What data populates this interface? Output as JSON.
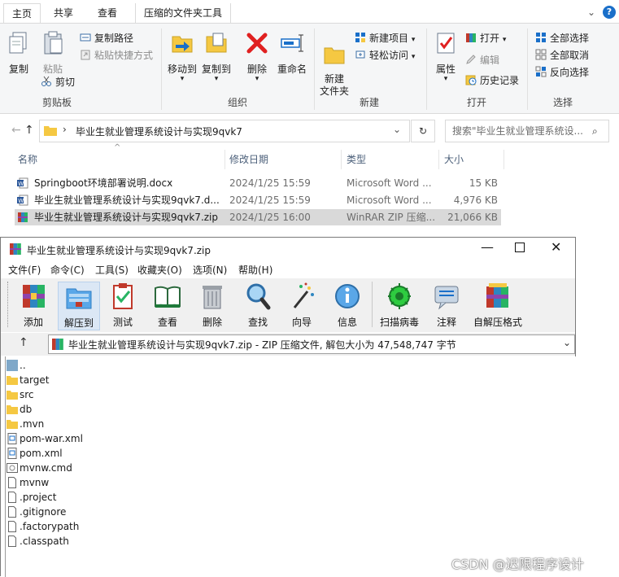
{
  "explorer": {
    "tabs": [
      "主页",
      "共享",
      "查看",
      "压缩的文件夹工具"
    ],
    "ribbon": {
      "clipboard": {
        "copy": "复制",
        "paste": "粘贴",
        "copy_path": "复制路径",
        "paste_shortcut": "粘贴快捷方式",
        "cut": "剪切",
        "label": "剪贴板"
      },
      "organize": {
        "move_to": "移动到",
        "copy_to": "复制到",
        "delete": "删除",
        "rename": "重命名",
        "label": "组织"
      },
      "new": {
        "new_folder": "新建\n文件夹",
        "new_item": "新建项目",
        "easy_access": "轻松访问",
        "label": "新建"
      },
      "open": {
        "properties": "属性",
        "open": "打开",
        "edit": "编辑",
        "history": "历史记录",
        "label": "打开"
      },
      "select": {
        "select_all": "全部选择",
        "select_none": "全部取消",
        "invert": "反向选择",
        "label": "选择"
      }
    },
    "address": {
      "path": "毕业生就业管理系统设计与实现9qvk7",
      "search_placeholder": "搜索\"毕业生就业管理系统设...",
      "separator": "›"
    },
    "columns": [
      "名称",
      "修改日期",
      "类型",
      "大小"
    ],
    "files": [
      {
        "name": "Springboot环境部署说明.docx",
        "date": "2024/1/25 15:59",
        "type": "Microsoft Word ...",
        "size": "15 KB",
        "icon": "word"
      },
      {
        "name": "毕业生就业管理系统设计与实现9qvk7.d...",
        "date": "2024/1/25 15:59",
        "type": "Microsoft Word ...",
        "size": "4,976 KB",
        "icon": "word"
      },
      {
        "name": "毕业生就业管理系统设计与实现9qvk7.zip",
        "date": "2024/1/25 16:00",
        "type": "WinRAR ZIP 压缩...",
        "size": "21,066 KB",
        "icon": "winrar"
      }
    ]
  },
  "winrar": {
    "title": "毕业生就业管理系统设计与实现9qvk7.zip",
    "menu": [
      "文件(F)",
      "命令(C)",
      "工具(S)",
      "收藏夹(O)",
      "选项(N)",
      "帮助(H)"
    ],
    "toolbar": [
      "添加",
      "解压到",
      "测试",
      "查看",
      "删除",
      "查找",
      "向导",
      "信息",
      "扫描病毒",
      "注释",
      "自解压格式"
    ],
    "path_text": "毕业生就业管理系统设计与实现9qvk7.zip - ZIP 压缩文件, 解包大小为 47,548,747 字节",
    "entries": [
      {
        "name": "..",
        "icon": "up"
      },
      {
        "name": "target",
        "icon": "folder"
      },
      {
        "name": "src",
        "icon": "folder"
      },
      {
        "name": "db",
        "icon": "folder"
      },
      {
        "name": ".mvn",
        "icon": "folder"
      },
      {
        "name": "pom-war.xml",
        "icon": "xml"
      },
      {
        "name": "pom.xml",
        "icon": "xml"
      },
      {
        "name": "mvnw.cmd",
        "icon": "cmd"
      },
      {
        "name": "mvnw",
        "icon": "file"
      },
      {
        "name": ".project",
        "icon": "file"
      },
      {
        "name": ".gitignore",
        "icon": "file"
      },
      {
        "name": ".factorypath",
        "icon": "file"
      },
      {
        "name": ".classpath",
        "icon": "file"
      }
    ]
  },
  "watermark": "CSDN @迟限程序设计",
  "colors": {
    "folder": "#f5c842",
    "accent_blue": "#1a6fc9",
    "selected_row": "#d9d9d9",
    "delete_red": "#e02020"
  }
}
